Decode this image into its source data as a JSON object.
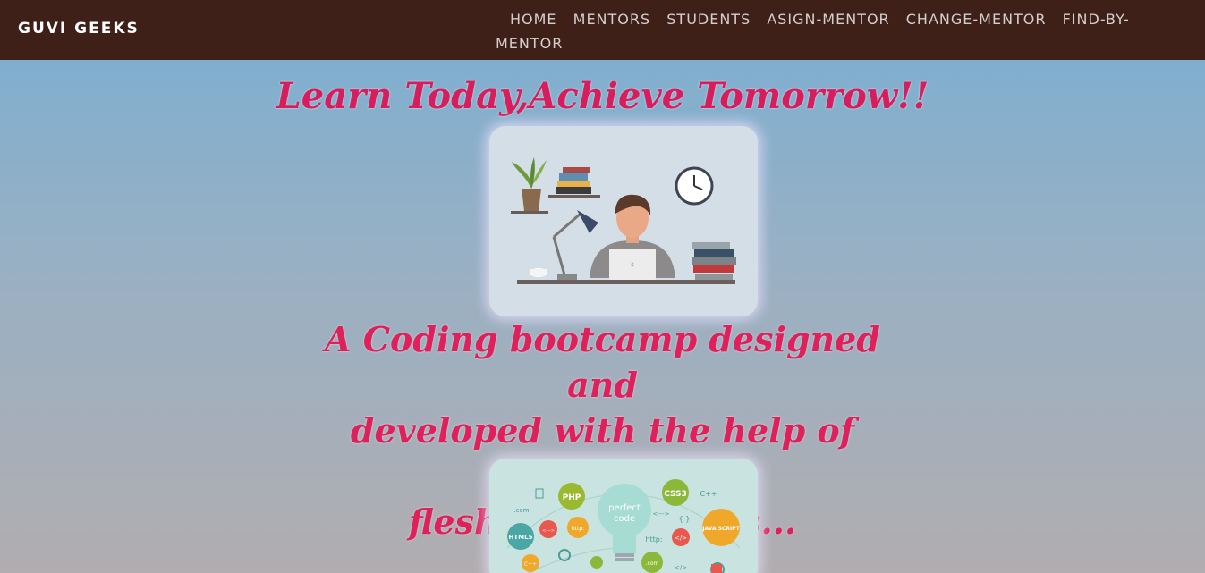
{
  "navbar": {
    "brand": "GUVI GEEKS",
    "links": [
      "HOME",
      "MENTORS",
      "STUDENTS",
      "ASIGN-MENTOR",
      "CHANGE-MENTOR",
      "FIND-BY-",
      "MENTOR"
    ]
  },
  "hero": {
    "tagline": "Learn Today,Achieve Tomorrow!!",
    "description_lines": [
      "A Coding bootcamp designed and",
      "developed with the help of fully",
      "fleshed developers..."
    ]
  },
  "images": {
    "coding_illustration": {
      "labels": [
        "PHP",
        "CSS3",
        "C++",
        "perfect",
        "code",
        "HTML5",
        "JAVA SCRIPT",
        "http:",
        "http:",
        ".com",
        ".com",
        "<--->",
        "<--->",
        "</>",
        "</>",
        "C++",
        "{ }"
      ]
    }
  },
  "colors": {
    "navbar_bg": "#3e2019",
    "tagline": "#d81d5d",
    "description": "#e0205a"
  }
}
